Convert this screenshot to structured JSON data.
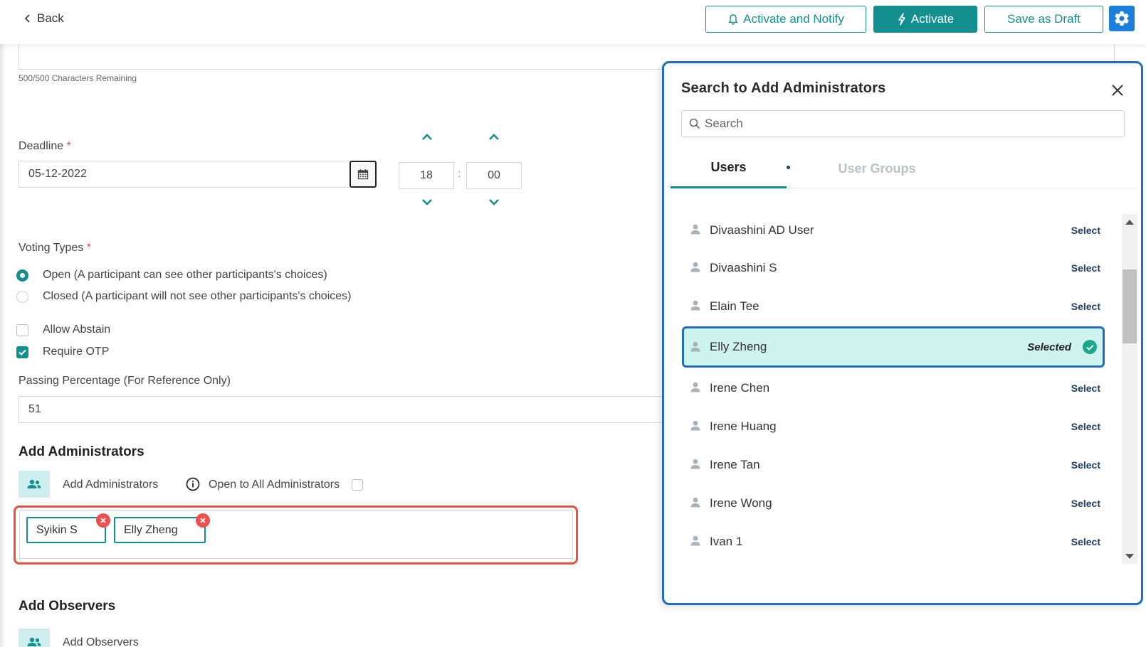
{
  "header": {
    "back_label": "Back",
    "activate_notify_label": "Activate and Notify",
    "activate_label": "Activate",
    "save_draft_label": "Save as Draft"
  },
  "form": {
    "chars_remaining": "500/500 Characters Remaining",
    "deadline_label": "Deadline",
    "required_mark": "*",
    "deadline_date": "05-12-2022",
    "deadline_hour": "18",
    "deadline_minute": "00",
    "time_separator": ":",
    "voting_types_label": "Voting Types",
    "voting_open": "Open (A participant can see other participants's choices)",
    "voting_closed": "Closed (A participant will not see other participants's choices)",
    "voting_selected": "open",
    "allow_abstain_label": "Allow Abstain",
    "allow_abstain_checked": false,
    "require_otp_label": "Require OTP",
    "require_otp_checked": true,
    "passing_label": "Passing Percentage (For Reference Only)",
    "passing_value": "51"
  },
  "administrators": {
    "section_title": "Add Administrators",
    "add_label": "Add Administrators",
    "open_to_all_label": "Open to All Administrators",
    "open_to_all_checked": false,
    "chips": [
      "Syikin S",
      "Elly Zheng"
    ]
  },
  "observers": {
    "section_title": "Add Observers",
    "add_label": "Add Observers"
  },
  "panel": {
    "title": "Search to Add Administrators",
    "search_placeholder": "Search",
    "tabs": [
      "Users",
      "User Groups"
    ],
    "active_tab": "Users",
    "select_label": "Select",
    "selected_label": "Selected",
    "users": [
      {
        "name": "Divaashini AD User",
        "status": "Select"
      },
      {
        "name": "Divaashini S",
        "status": "Select"
      },
      {
        "name": "Elain Tee",
        "status": "Select"
      },
      {
        "name": "Elly Zheng",
        "status": "Selected"
      },
      {
        "name": "Irene Chen",
        "status": "Select"
      },
      {
        "name": "Irene Huang",
        "status": "Select"
      },
      {
        "name": "Irene Tan",
        "status": "Select"
      },
      {
        "name": "Irene Wong",
        "status": "Select"
      },
      {
        "name": "Ivan 1",
        "status": "Select"
      }
    ]
  },
  "colors": {
    "accent": "#138f8f",
    "highlight_blue": "#1f6fbd",
    "highlight_red": "#e35442",
    "selected_row_bg": "#cff3ee",
    "settings_blue": "#1c7fdc"
  },
  "icons": {
    "back": "chevron-left-icon",
    "notify": "bell-icon",
    "activate": "lightning-icon",
    "settings": "gear-icon",
    "calendar": "calendar-icon",
    "info": "info-icon",
    "add_people": "users-icon",
    "remove_chip": "close-icon",
    "close_panel": "close-icon",
    "search": "search-icon",
    "user": "person-icon",
    "selected_check": "check-circle-icon"
  }
}
